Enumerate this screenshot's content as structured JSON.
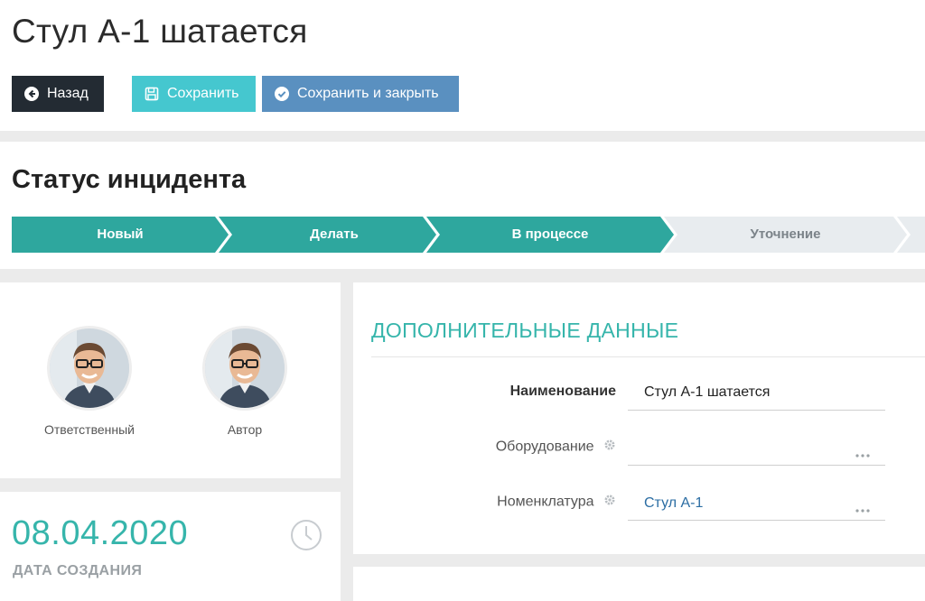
{
  "header": {
    "title": "Стул А-1 шатается",
    "buttons": {
      "back": "Назад",
      "save": "Сохранить",
      "save_close": "Сохранить и закрыть"
    }
  },
  "status": {
    "title": "Статус инцидента",
    "steps": [
      {
        "label": "Новый",
        "state": "done"
      },
      {
        "label": "Делать",
        "state": "done"
      },
      {
        "label": "В процессе",
        "state": "current"
      },
      {
        "label": "Уточнение",
        "state": "pending"
      }
    ],
    "colors": {
      "active": "#2ea79e",
      "inactive": "#e8ecef"
    }
  },
  "people": {
    "responsible_label": "Ответственный",
    "author_label": "Автор"
  },
  "created": {
    "date": "08.04.2020",
    "label": "ДАТА СОЗДАНИЯ"
  },
  "details": {
    "title": "ДОПОЛНИТЕЛЬНЫЕ ДАННЫЕ",
    "fields": {
      "name": {
        "label": "Наименование",
        "value": "Стул А-1 шатается"
      },
      "equipment": {
        "label": "Оборудование",
        "value": ""
      },
      "nomenclature": {
        "label": "Номенклатура",
        "value": "Стул А-1"
      }
    }
  }
}
